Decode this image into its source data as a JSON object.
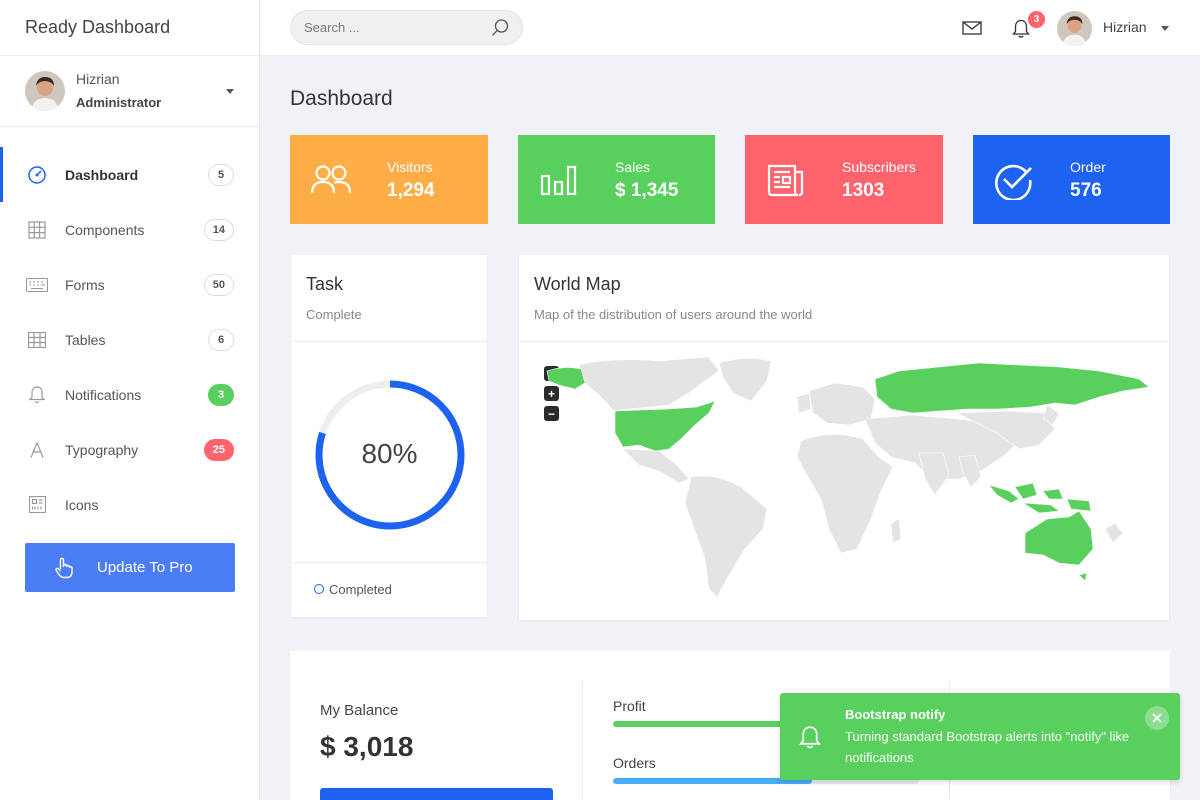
{
  "brand": "Ready Dashboard",
  "user": {
    "name": "Hizrian",
    "role": "Administrator"
  },
  "sidebar": {
    "items": [
      {
        "label": "Dashboard",
        "badge": "5"
      },
      {
        "label": "Components",
        "badge": "14"
      },
      {
        "label": "Forms",
        "badge": "50"
      },
      {
        "label": "Tables",
        "badge": "6"
      },
      {
        "label": "Notifications",
        "badge": "3"
      },
      {
        "label": "Typography",
        "badge": "25"
      },
      {
        "label": "Icons",
        "badge": ""
      }
    ],
    "pro_button": "Update To Pro"
  },
  "topbar": {
    "search_placeholder": "Search ...",
    "notification_count": "3",
    "user_name": "Hizrian"
  },
  "page_title": "Dashboard",
  "stats": [
    {
      "label": "Visitors",
      "value": "1,294",
      "color": "#ffad46"
    },
    {
      "label": "Sales",
      "value": "$ 1,345",
      "color": "#59d05d"
    },
    {
      "label": "Subscribers",
      "value": "1303",
      "color": "#ff646d"
    },
    {
      "label": "Order",
      "value": "576",
      "color": "#1d62f0"
    }
  ],
  "task": {
    "title": "Task",
    "subtitle": "Complete",
    "percent_text": "80%",
    "percent": 80,
    "legend": "Completed"
  },
  "world_map": {
    "title": "World Map",
    "subtitle": "Map of the distribution of users around the world",
    "highlight_color": "#59d05d",
    "base_color": "#e4e4e4"
  },
  "balance": {
    "label": "My Balance",
    "value": "$ 3,018",
    "progress": [
      {
        "label": "Profit",
        "percent": 100,
        "color": "#59d05d"
      },
      {
        "label": "Orders",
        "percent": 65,
        "color": "#48abf7"
      }
    ]
  },
  "toast": {
    "title": "Bootstrap notify",
    "message": "Turning standard Bootstrap alerts into \"notify\" like notifications"
  }
}
